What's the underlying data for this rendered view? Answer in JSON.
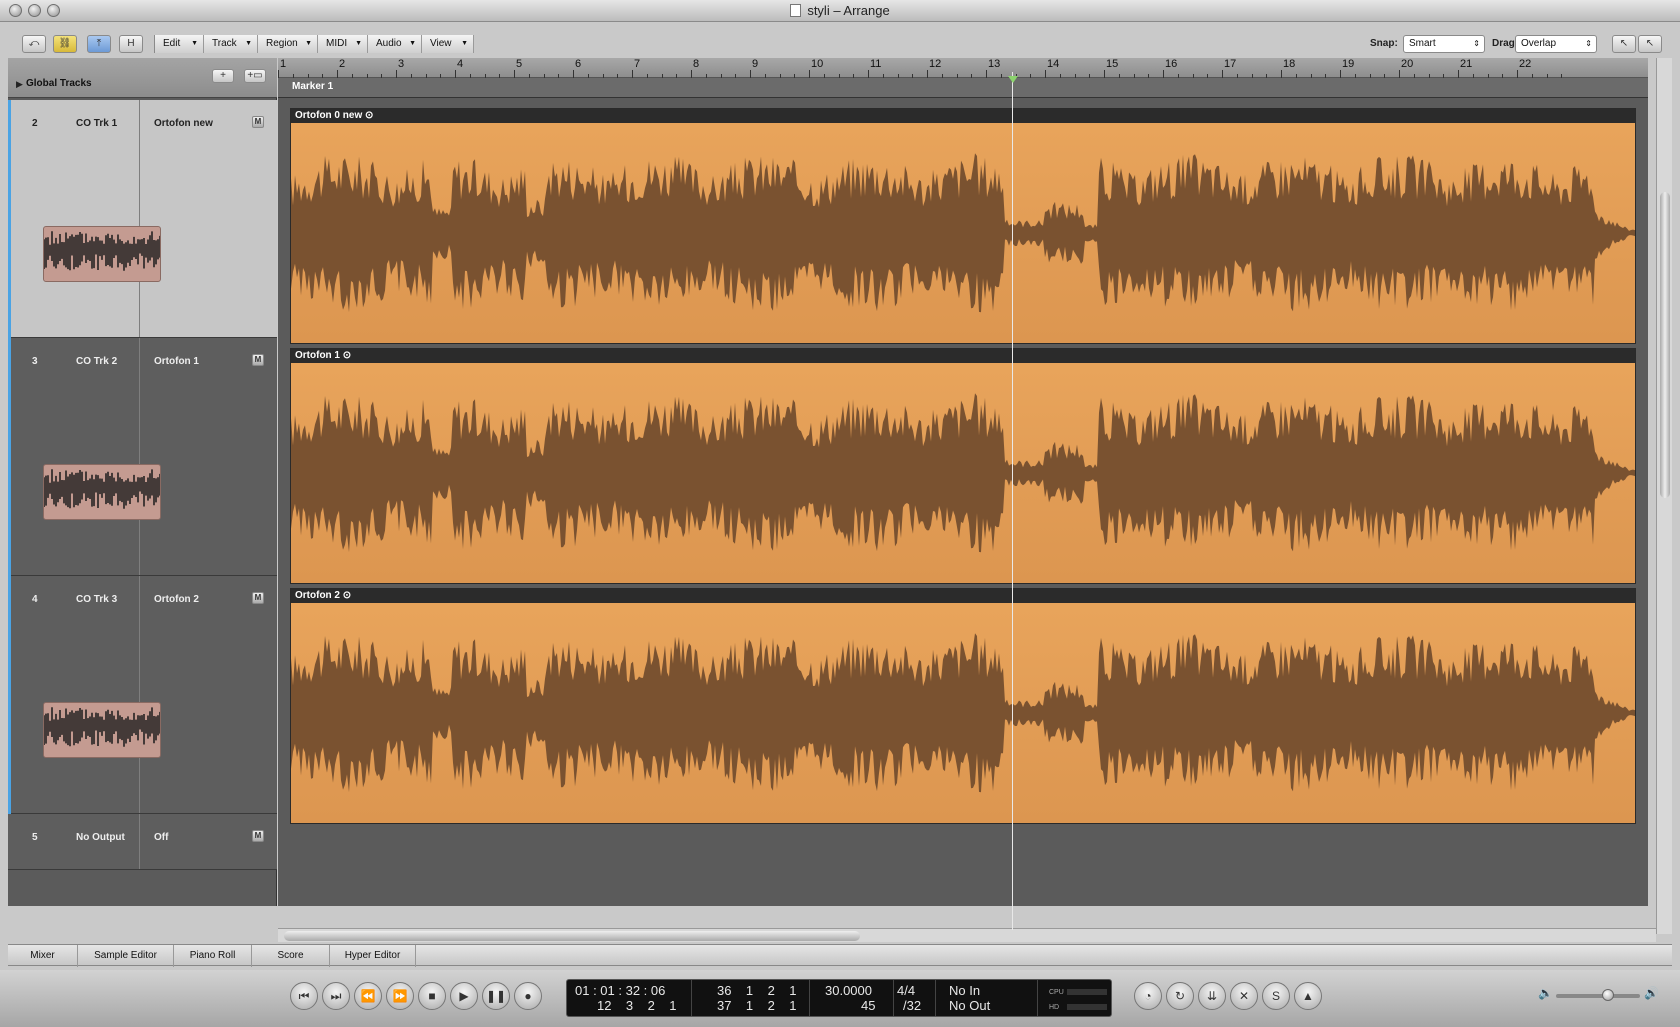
{
  "window": {
    "title": "styli – Arrange"
  },
  "toolbar": {
    "menus": [
      "Edit",
      "Track",
      "Region",
      "MIDI",
      "Audio",
      "View"
    ],
    "h_button": "H",
    "snap_label": "Snap:",
    "snap_value": "Smart",
    "drag_label": "Drag:",
    "drag_value": "Overlap"
  },
  "global_tracks": {
    "label": "Global Tracks",
    "add_button": "+"
  },
  "ruler": {
    "bars": [
      "1",
      "2",
      "3",
      "4",
      "5",
      "6",
      "7",
      "8",
      "9",
      "10",
      "11",
      "12",
      "13",
      "14",
      "15",
      "16",
      "17",
      "18",
      "19",
      "20",
      "21",
      "22"
    ]
  },
  "marker": {
    "label": "Marker 1"
  },
  "tracks": [
    {
      "number": "2",
      "name": "CO Trk 1",
      "channel": "Ortofon new",
      "mute": "M",
      "selected": true
    },
    {
      "number": "3",
      "name": "CO Trk 2",
      "channel": "Ortofon 1",
      "mute": "M",
      "selected": false
    },
    {
      "number": "4",
      "name": "CO Trk 3",
      "channel": "Ortofon 2",
      "mute": "M",
      "selected": false
    },
    {
      "number": "5",
      "name": "No Output",
      "channel": "Off",
      "mute": "M",
      "selected": false
    }
  ],
  "regions": [
    {
      "title": "Ortofon 0 new",
      "color": "#e5a15a"
    },
    {
      "title": "Ortofon 1",
      "color": "#e5a15a"
    },
    {
      "title": "Ortofon 2",
      "color": "#e5a15a"
    }
  ],
  "bottom_tabs": [
    "Mixer",
    "Sample Editor",
    "Piano Roll",
    "Score",
    "Hyper Editor"
  ],
  "transport": {
    "smpte": "01 : 01 : 32 : 06",
    "smpte_sub": "12    3    2    1",
    "position": "36    1    2    1",
    "position2": "37    1    2    1",
    "tempo": "30.0000",
    "tempo_sub": "45",
    "signature": "4/4",
    "division": "/32",
    "in": "No In",
    "out": "No Out",
    "cpu_label": "CPU",
    "hd_label": "HD"
  },
  "colors": {
    "region": "#e5a15a",
    "waveform": "#7a5230",
    "selection": "#4aa3e4",
    "playhead_marker": "#8cd36e"
  }
}
